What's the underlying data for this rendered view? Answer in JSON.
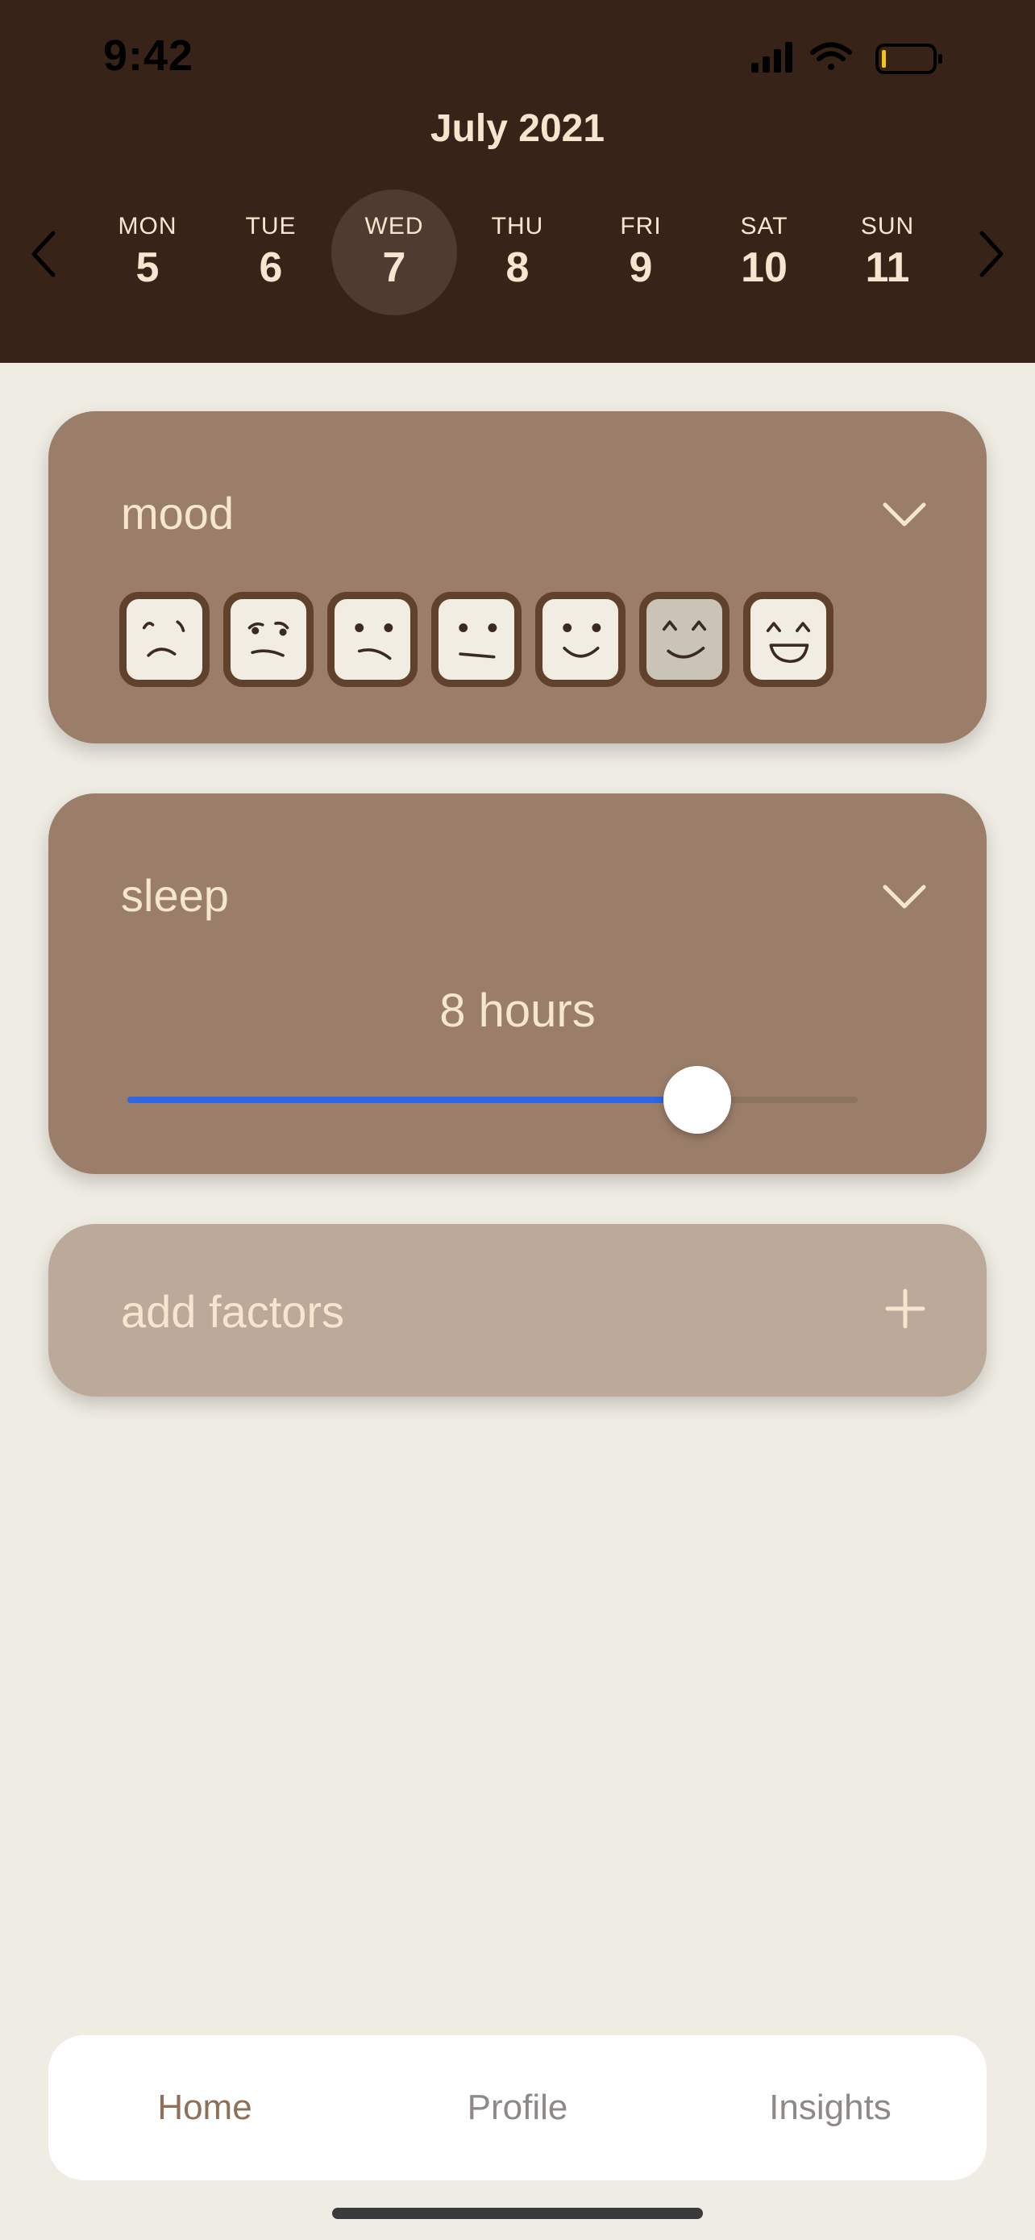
{
  "status_bar": {
    "time": "9:42"
  },
  "calendar": {
    "month_label": "July 2021",
    "days": [
      {
        "name": "MON",
        "num": "5"
      },
      {
        "name": "TUE",
        "num": "6"
      },
      {
        "name": "WED",
        "num": "7"
      },
      {
        "name": "THU",
        "num": "8"
      },
      {
        "name": "FRI",
        "num": "9"
      },
      {
        "name": "SAT",
        "num": "10"
      },
      {
        "name": "SUN",
        "num": "11"
      }
    ],
    "selected_day": "7"
  },
  "mood": {
    "title": "mood",
    "faces": [
      "very-sad-face-icon",
      "skeptical-face-icon",
      "frowning-face-icon",
      "neutral-face-icon",
      "smiling-face-icon",
      "happy-face-icon",
      "laughing-face-icon"
    ],
    "selected_face": "happy-face-icon"
  },
  "sleep": {
    "title": "sleep",
    "value_label": "8 hours",
    "slider_fraction": 0.78
  },
  "add_factors": {
    "label": "add factors"
  },
  "tabs": {
    "items": [
      {
        "label": "Home"
      },
      {
        "label": "Profile"
      },
      {
        "label": "Insights"
      }
    ],
    "active": "Home"
  },
  "colors": {
    "header_bg": "#382318",
    "page_bg": "#efece3",
    "card_bg": "#9b7e6a",
    "add_card_bg": "#bba999",
    "text_cream": "#f6e6cf",
    "slider_blue": "#2f66e6"
  }
}
